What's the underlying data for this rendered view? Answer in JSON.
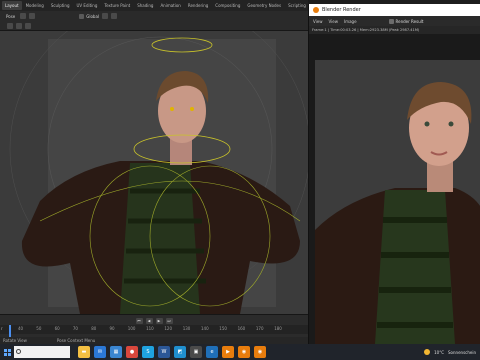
{
  "workspace_tabs": [
    "Layout",
    "Modeling",
    "Sculpting",
    "UV Editing",
    "Texture Paint",
    "Shading",
    "Animation",
    "Rendering",
    "Compositing",
    "Geometry Nodes",
    "Scripting"
  ],
  "header": {
    "mode": "Pose",
    "orientation": "Global"
  },
  "timeline": {
    "ticks": [
      "40",
      "50",
      "60",
      "70",
      "80",
      "90",
      "100",
      "110",
      "120",
      "130",
      "140",
      "150",
      "160",
      "170",
      "180"
    ],
    "current_frame_label": "r"
  },
  "status_bar": {
    "left": "Rotate View",
    "middle": "Pose Context Menu"
  },
  "render_window": {
    "title": "Blender Render",
    "menu": [
      "View",
      "View",
      "Image"
    ],
    "slot": "Render Result",
    "stats": "Frame:1 | Time:00:03.26 | Mem:2923.38M (Peak 2987.41M)"
  },
  "taskbar": {
    "search_placeholder": "",
    "apps": [
      {
        "name": "file-explorer-icon",
        "color": "#f4c043",
        "glyph": "▬"
      },
      {
        "name": "mail-icon",
        "color": "#2b78d6",
        "glyph": "✉"
      },
      {
        "name": "store-icon",
        "color": "#3a86d1",
        "glyph": "▦"
      },
      {
        "name": "chrome-icon",
        "color": "#d9473c",
        "glyph": "●"
      },
      {
        "name": "skype-icon",
        "color": "#1fa3e0",
        "glyph": "S"
      },
      {
        "name": "word-icon",
        "color": "#2b5797",
        "glyph": "W"
      },
      {
        "name": "photos-icon",
        "color": "#1f8fcf",
        "glyph": "◩"
      },
      {
        "name": "tiles-icon",
        "color": "#4a4a4a",
        "glyph": "▣"
      },
      {
        "name": "edge-icon",
        "color": "#1f6fb8",
        "glyph": "e"
      },
      {
        "name": "media-icon",
        "color": "#e87d0d",
        "glyph": "▶"
      },
      {
        "name": "blender-icon",
        "color": "#e87d0d",
        "glyph": "◉"
      },
      {
        "name": "blender-render-icon",
        "color": "#e87d0d",
        "glyph": "◉"
      }
    ],
    "weather": "10°C",
    "weather_text": "Sonnenschein"
  },
  "colors": {
    "accent": "#4b8ff0",
    "bone_outline": "#c9c32a",
    "blender_orange": "#e87d0d"
  }
}
